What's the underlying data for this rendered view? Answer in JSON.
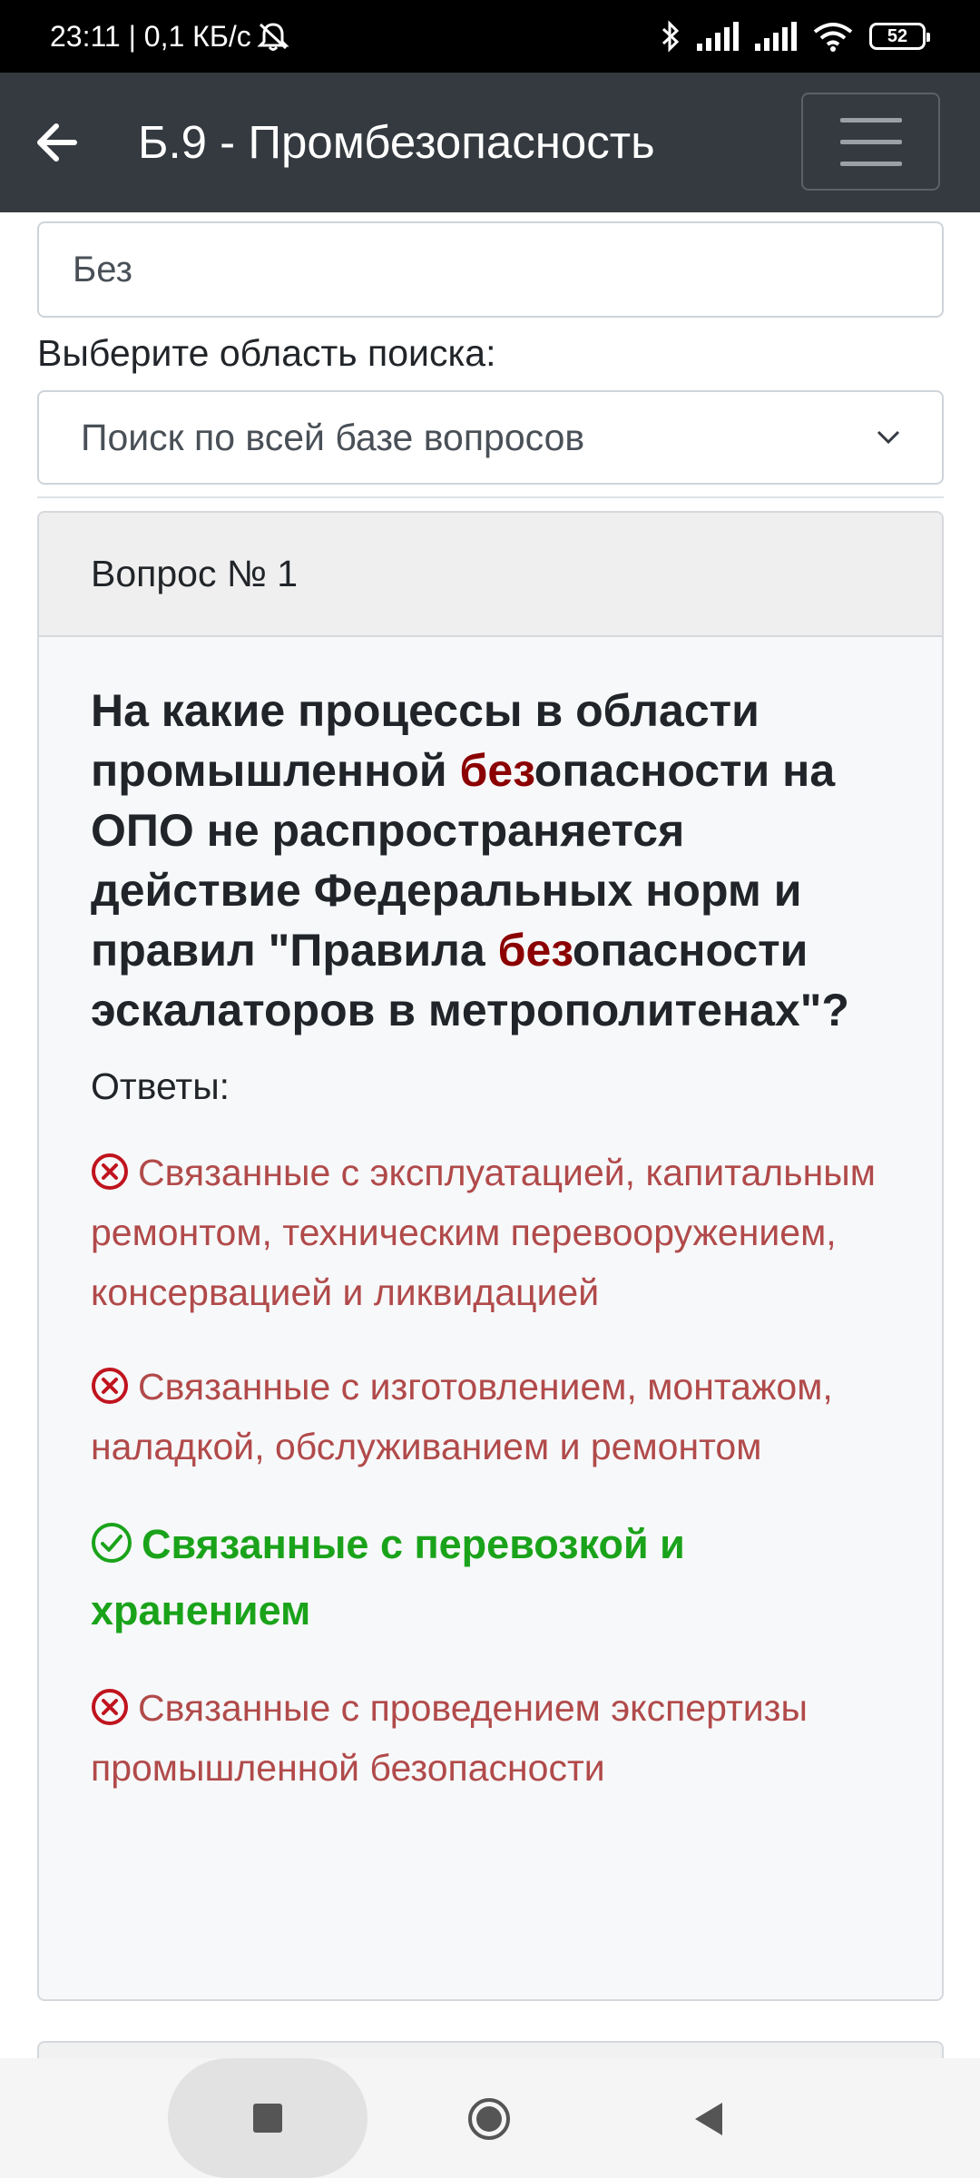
{
  "status_bar": {
    "time_network": "23:11 | 0,1 КБ/с",
    "battery": "52"
  },
  "app_bar": {
    "title": "Б.9 - Промбезопасность"
  },
  "search": {
    "value": "Без"
  },
  "scope": {
    "label": "Выберите область поиска:",
    "selected": "Поиск по всей базе вопросов"
  },
  "question_card": {
    "header": "Вопрос № 1",
    "question_parts": [
      "На какие процессы в области промышленной ",
      "без",
      "опасности на ОПО не распространяется действие Федеральных норм и правил \"Правила ",
      "без",
      "опасности эскалаторов в метрополитенах\"?"
    ],
    "answers_label": "Ответы:",
    "answers": [
      {
        "text": "Связанные с эксплуатацией, капитальным ремонтом, техническим перевооружением, консервацией и ликвидацией",
        "correct": false
      },
      {
        "text": "Связанные с изготовлением, монтажом, наладкой, обслуживанием и ремонтом",
        "correct": false
      },
      {
        "text": "Связанные с перевозкой и хранением",
        "correct": true
      },
      {
        "text": "Связанные с проведением экспертизы промышленной безопасности",
        "correct": false
      }
    ]
  },
  "colors": {
    "app_bar": "#343a40",
    "highlight": "#8b0000",
    "wrong": "#b14a4a",
    "correct": "#1aa31a"
  },
  "icons": [
    "arrow-left-icon",
    "hamburger-menu-icon",
    "chevron-down-icon",
    "x-circle-icon",
    "check-circle-icon",
    "bluetooth-icon",
    "signal-icon",
    "wifi-icon",
    "battery-icon",
    "silent-icon"
  ]
}
